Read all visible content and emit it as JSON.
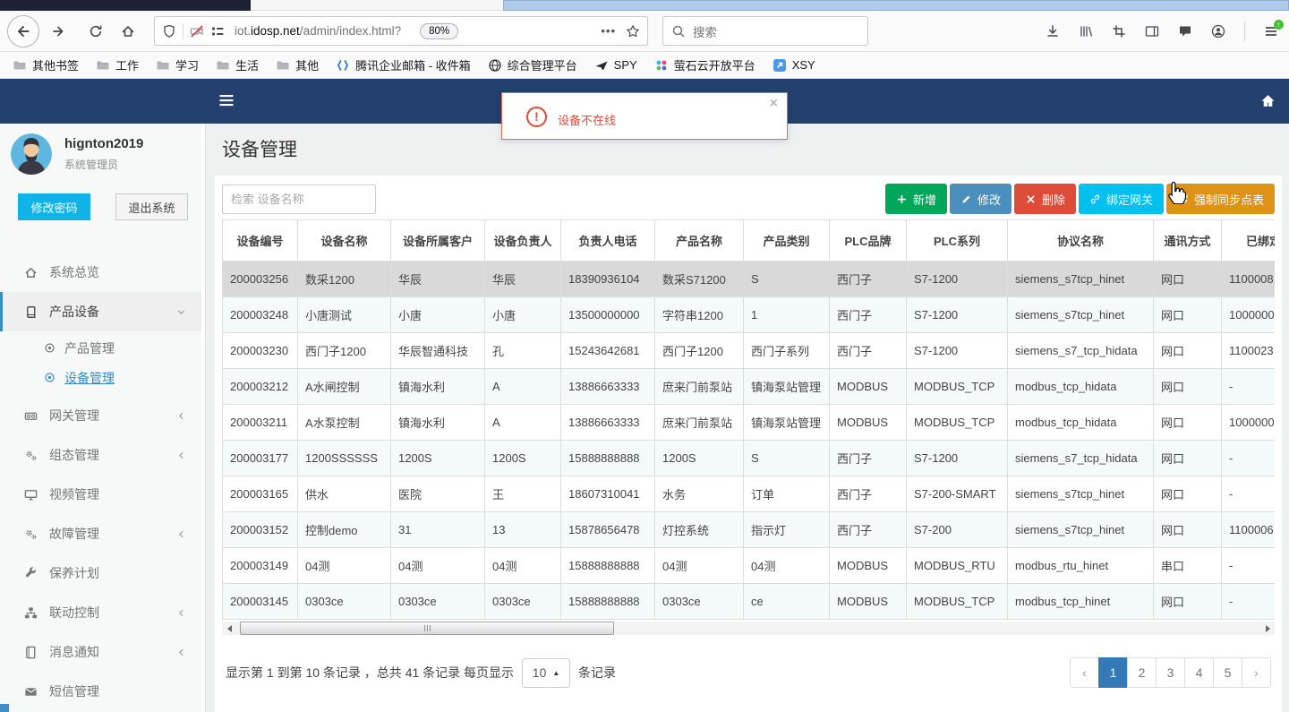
{
  "browser": {
    "toolbar": {
      "url_prefix": "iot.",
      "url_domain": "idosp.net",
      "url_path": "/admin/index.html?",
      "zoom_badge": "80%",
      "page_actions": "•••",
      "search_placeholder": "搜索"
    },
    "bookmarks": [
      {
        "label": "其他书签",
        "icon": "folder"
      },
      {
        "label": "工作",
        "icon": "folder"
      },
      {
        "label": "学习",
        "icon": "folder"
      },
      {
        "label": "生活",
        "icon": "folder"
      },
      {
        "label": "其他",
        "icon": "folder"
      },
      {
        "label": "腾讯企业邮箱 - 收件箱",
        "icon": "tencent-mail"
      },
      {
        "label": "综合管理平台",
        "icon": "globe"
      },
      {
        "label": "SPY",
        "icon": "spy"
      },
      {
        "label": "萤石云开放平台",
        "icon": "ys7"
      },
      {
        "label": "XSY",
        "icon": "xsy"
      }
    ]
  },
  "app": {
    "colors": {
      "navbar": "#24406e",
      "accent": "#3c8dbc",
      "aqua": "#0fb3e8",
      "pgactive": "#337ab7",
      "alert": "#dd4b39",
      "selrow": "#d9d9d9"
    },
    "alert": {
      "message": "设备不在线",
      "close": "×"
    },
    "sidebar": {
      "user": {
        "name": "hignton2019",
        "role": "系统管理员"
      },
      "change_password": "修改密码",
      "logout": "退出系统",
      "menu": [
        {
          "label": "系统总览",
          "icon": "home"
        },
        {
          "label": "产品设备",
          "icon": "product",
          "active": true,
          "expanded": true,
          "children": [
            {
              "label": "产品管理",
              "active": false
            },
            {
              "label": "设备管理",
              "active": true
            }
          ]
        },
        {
          "label": "网关管理",
          "icon": "gateway",
          "collapsible": true
        },
        {
          "label": "组态管理",
          "icon": "gears",
          "collapsible": true
        },
        {
          "label": "视频管理",
          "icon": "monitor"
        },
        {
          "label": "故障管理",
          "icon": "gears",
          "collapsible": true
        },
        {
          "label": "保养计划",
          "icon": "wrench"
        },
        {
          "label": "联动控制",
          "icon": "sitemap",
          "collapsible": true
        },
        {
          "label": "消息通知",
          "icon": "notebook",
          "collapsible": true
        },
        {
          "label": "短信管理",
          "icon": "envelope"
        }
      ]
    },
    "page": {
      "title": "设备管理",
      "search_placeholder": "检索 设备名称",
      "action_buttons": [
        {
          "name": "add-button",
          "label": "新增",
          "icon": "plus",
          "color": "#00a65a"
        },
        {
          "name": "edit-button",
          "label": "修改",
          "icon": "pencil",
          "color": "#4a8fbe"
        },
        {
          "name": "delete-button",
          "label": "删除",
          "icon": "cross",
          "color": "#dd4b39"
        },
        {
          "name": "bind-gateway-button",
          "label": "绑定网关",
          "icon": "link",
          "color": "#00c0ef"
        },
        {
          "name": "force-sync-button",
          "label": "强制同步点表",
          "icon": "refresh",
          "color": "#de9216"
        }
      ],
      "table": {
        "columns": [
          "设备编号",
          "设备名称",
          "设备所属客户",
          "设备负责人",
          "负责人电话",
          "产品名称",
          "产品类别",
          "PLC品牌",
          "PLC系列",
          "协议名称",
          "通讯方式",
          "已绑定网关"
        ],
        "selected_row_index": 0,
        "rows": [
          [
            "200003256",
            "数采1200",
            "华辰",
            "华辰",
            "18390936104",
            "数采S71200",
            "S",
            "西门子",
            "S7-1200",
            "siemens_s7tcp_hinet",
            "网口",
            "1100008"
          ],
          [
            "200003248",
            "小唐测试",
            "小唐",
            "小唐",
            "13500000000",
            "字符串1200",
            "1",
            "西门子",
            "S7-1200",
            "siemens_s7tcp_hinet",
            "网口",
            "1000000"
          ],
          [
            "200003230",
            "西门子1200",
            "华辰智通科技",
            "孔",
            "15243642681",
            "西门子1200",
            "西门子系列",
            "西门子",
            "S7-1200",
            "siemens_s7_tcp_hidata",
            "网口",
            "1100023"
          ],
          [
            "200003212",
            "A水闸控制",
            "镇海水利",
            "A",
            "13886663333",
            "庶来门前泵站",
            "镇海泵站管理",
            "MODBUS",
            "MODBUS_TCP",
            "modbus_tcp_hidata",
            "网口",
            "-"
          ],
          [
            "200003211",
            "A水泵控制",
            "镇海水利",
            "A",
            "13886663333",
            "庶来门前泵站",
            "镇海泵站管理",
            "MODBUS",
            "MODBUS_TCP",
            "modbus_tcp_hidata",
            "网口",
            "1000000"
          ],
          [
            "200003177",
            "1200SSSSSS",
            "1200S",
            "1200S",
            "15888888888",
            "1200S",
            "S",
            "西门子",
            "S7-1200",
            "siemens_s7_tcp_hidata",
            "网口",
            "-"
          ],
          [
            "200003165",
            "供水",
            "医院",
            "王",
            "18607310041",
            "水务",
            "订单",
            "西门子",
            "S7-200-SMART",
            "siemens_s7tcp_hinet",
            "网口",
            "-"
          ],
          [
            "200003152",
            "控制demo",
            "31",
            "13",
            "15878656478",
            "灯控系统",
            "指示灯",
            "西门子",
            "S7-200",
            "siemens_s7tcp_hinet",
            "网口",
            "1100006"
          ],
          [
            "200003149",
            "04测",
            "04测",
            "04测",
            "15888888888",
            "04测",
            "04测",
            "MODBUS",
            "MODBUS_RTU",
            "modbus_rtu_hinet",
            "串口",
            "-"
          ],
          [
            "200003145",
            "0303ce",
            "0303ce",
            "0303ce",
            "15888888888",
            "0303ce",
            "ce",
            "MODBUS",
            "MODBUS_TCP",
            "modbus_tcp_hinet",
            "网口",
            "-"
          ]
        ]
      },
      "footer": {
        "summary": "显示第 1 到第 10 条记录 ，总共 41 条记录 每页显示",
        "per_page": "10",
        "caret": "▲",
        "suffix": "条记录"
      },
      "pagination": {
        "prev": "‹",
        "pages": [
          "1",
          "2",
          "3",
          "4",
          "5"
        ],
        "active": "1",
        "next": "›"
      }
    }
  }
}
